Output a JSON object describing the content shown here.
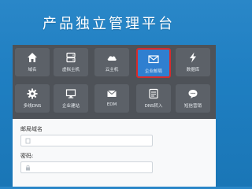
{
  "header": {
    "title": "产品独立管理平台"
  },
  "tiles": [
    {
      "label": "域名",
      "icon": "home-icon"
    },
    {
      "label": "虚拟主机",
      "icon": "server-icon"
    },
    {
      "label": "云主机",
      "icon": "cloud-icon"
    },
    {
      "label": "企业邮局",
      "icon": "mail-icon",
      "active": true
    },
    {
      "label": "数据库",
      "icon": "lightning-icon"
    },
    {
      "label": "多线DNS",
      "icon": "gear-icon"
    },
    {
      "label": "企业建站",
      "icon": "monitor-icon"
    },
    {
      "label": "EDM",
      "icon": "edm-mail-icon"
    },
    {
      "label": "DNS转入",
      "icon": "dns-transfer-icon"
    },
    {
      "label": "短信营销",
      "icon": "chat-icon"
    }
  ],
  "form": {
    "mailbox_domain_label": "邮局域名",
    "password_label": "密码:"
  },
  "colors": {
    "accent": "#2f7fd0",
    "highlight_border": "#d72b2b",
    "grid_bg": "#4e5258"
  }
}
